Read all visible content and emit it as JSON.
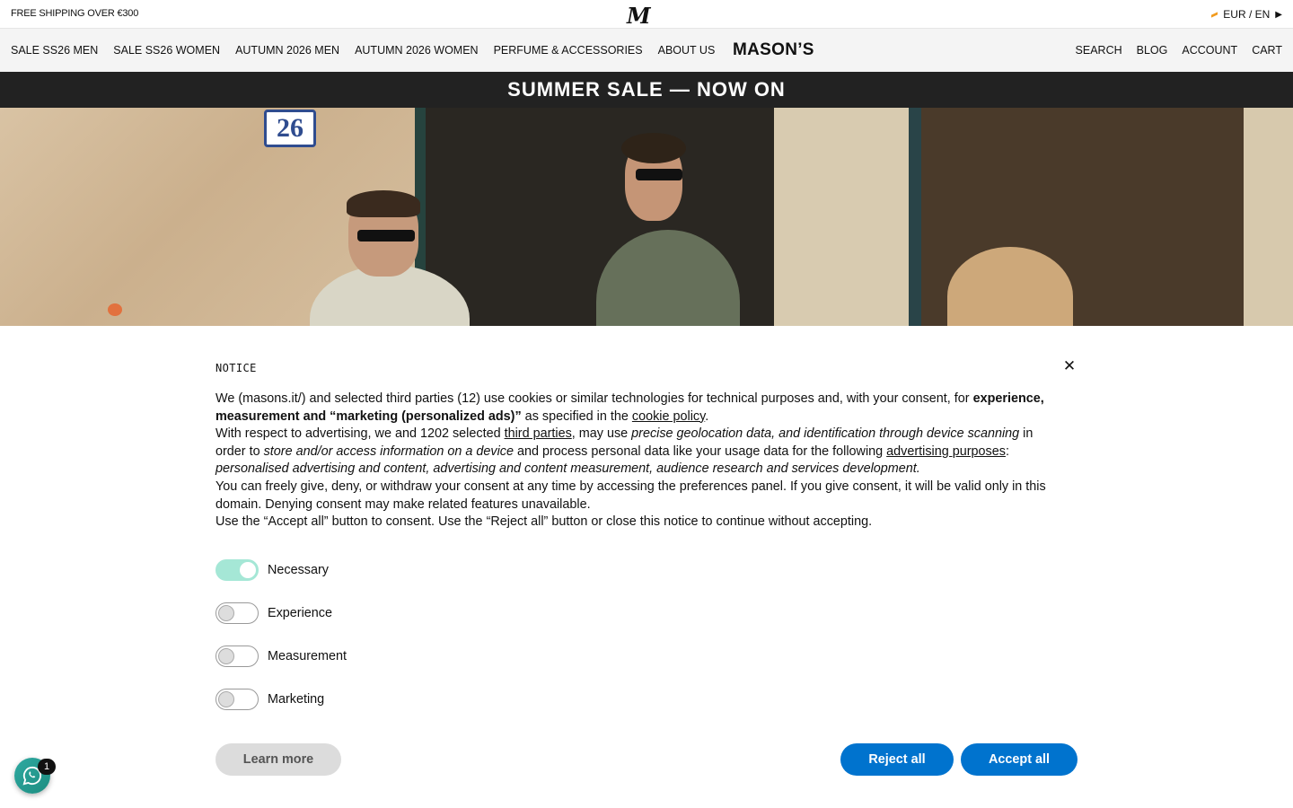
{
  "topbar": {
    "shipping": "FREE SHIPPING OVER €300",
    "monogram": "M",
    "locale": "EUR / EN",
    "flag_icon": "italy-flag-icon",
    "caret_icon": "chevron-right-icon"
  },
  "nav": {
    "items": [
      {
        "label": "SALE SS26 MEN"
      },
      {
        "label": "SALE SS26 WOMEN"
      },
      {
        "label": "AUTUMN 2026 MEN"
      },
      {
        "label": "AUTUMN 2026 WOMEN"
      },
      {
        "label": "PERFUME & ACCESSORIES"
      },
      {
        "label": "ABOUT US"
      }
    ],
    "brand": "MASON’S",
    "right": [
      {
        "label": "SEARCH"
      },
      {
        "label": "BLOG"
      },
      {
        "label": "ACCOUNT"
      },
      {
        "label": "CART"
      }
    ]
  },
  "sale_banner": "SUMMER SALE — NOW ON",
  "hero": {
    "house_number": "26"
  },
  "notice": {
    "title": "NOTICE",
    "close_icon": "close-icon",
    "p1_a": "We (masons.it/) and selected third parties (12) use cookies or similar technologies for technical purposes and, with your consent, for ",
    "p1_bold": "experience, measurement and “marketing (personalized ads)”",
    "p1_b": " as specified in the ",
    "p1_link": "cookie policy",
    "p1_c": ".",
    "p2_a": "With respect to advertising, we and 1202 selected ",
    "p2_link1": "third parties",
    "p2_b": ", may use ",
    "p2_italic1": "precise geolocation data, and identification through device scanning",
    "p2_c": " in order to ",
    "p2_italic2": "store and/or access information on a device",
    "p2_d": " and process personal data like your usage data for the following ",
    "p2_link2": "advertising purposes",
    "p2_e": ": ",
    "p2_italic3": "personalised advertising and content, advertising and content measurement, audience research and services development.",
    "p3": "You can freely give, deny, or withdraw your consent at any time by accessing the preferences panel. If you give consent, it will be valid only in this domain. Denying consent may make related features unavailable.",
    "p4": "Use the “Accept all” button to consent. Use the “Reject all” button or close this notice to continue without accepting.",
    "toggles": [
      {
        "label": "Necessary",
        "on": true
      },
      {
        "label": "Experience",
        "on": false
      },
      {
        "label": "Measurement",
        "on": false
      },
      {
        "label": "Marketing",
        "on": false
      }
    ],
    "learn_more": "Learn more",
    "reject_all": "Reject all",
    "accept_all": "Accept all",
    "accent_color": "#0073ce",
    "toggle_on_color": "#a5e7d6"
  },
  "chat": {
    "icon": "whatsapp-icon",
    "badge": "1"
  }
}
